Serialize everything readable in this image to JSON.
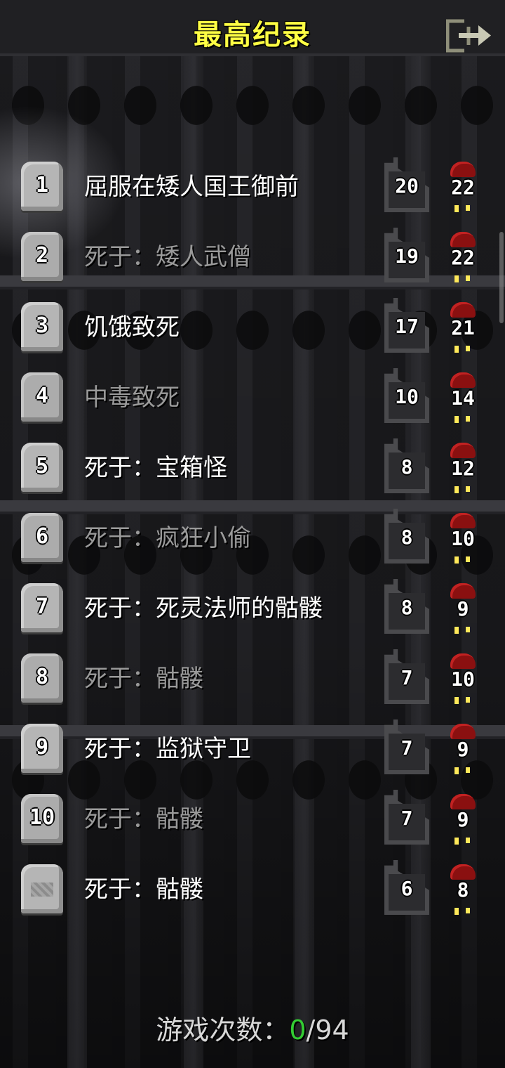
{
  "header": {
    "title": "最高纪录",
    "exit_icon": "exit-icon"
  },
  "records": [
    {
      "rank": "1",
      "description": "屈服在矮人国王御前",
      "depth": "20",
      "level": "22",
      "dim": false
    },
    {
      "rank": "2",
      "description": "死于：矮人武僧",
      "depth": "19",
      "level": "22",
      "dim": true
    },
    {
      "rank": "3",
      "description": "饥饿致死",
      "depth": "17",
      "level": "21",
      "dim": false
    },
    {
      "rank": "4",
      "description": "中毒致死",
      "depth": "10",
      "level": "14",
      "dim": true
    },
    {
      "rank": "5",
      "description": "死于：宝箱怪",
      "depth": "8",
      "level": "12",
      "dim": false
    },
    {
      "rank": "6",
      "description": "死于：疯狂小偷",
      "depth": "8",
      "level": "10",
      "dim": true
    },
    {
      "rank": "7",
      "description": "死于：死灵法师的骷髅",
      "depth": "8",
      "level": "9",
      "dim": false
    },
    {
      "rank": "8",
      "description": "死于：骷髅",
      "depth": "7",
      "level": "10",
      "dim": true
    },
    {
      "rank": "9",
      "description": "死于：监狱守卫",
      "depth": "7",
      "level": "9",
      "dim": false
    },
    {
      "rank": "10",
      "description": "死于：骷髅",
      "depth": "7",
      "level": "9",
      "dim": true
    },
    {
      "rank": "",
      "description": "死于：骷髅",
      "depth": "6",
      "level": "8",
      "dim": false
    }
  ],
  "footer": {
    "label": "游戏次数：",
    "wins": "0",
    "separator": "/",
    "total": "94"
  },
  "colors": {
    "title": "#ffff44",
    "wins": "#33cc33",
    "dim_text": "#9a9a9a",
    "level_cap": "#8a1010"
  }
}
